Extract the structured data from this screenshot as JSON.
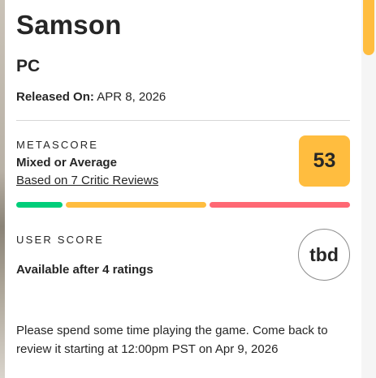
{
  "game": {
    "title": "Samson",
    "platform": "PC",
    "release_label": "Released On:",
    "release_date": "APR 8, 2026"
  },
  "metascore": {
    "section_label": "METASCORE",
    "description": "Mixed or Average",
    "reviews_link": "Based on 7 Critic Reviews",
    "score": "53",
    "score_color": "#ffbd3f",
    "distribution_colors": {
      "positive": "#00ce7a",
      "mixed": "#ffbd3f",
      "negative": "#ff6874"
    }
  },
  "user_score": {
    "section_label": "USER SCORE",
    "description": "Available after 4 ratings",
    "score": "tbd"
  },
  "note": "Please spend some time playing the game. Come back to review it starting at 12:00pm PST on Apr 9, 2026"
}
